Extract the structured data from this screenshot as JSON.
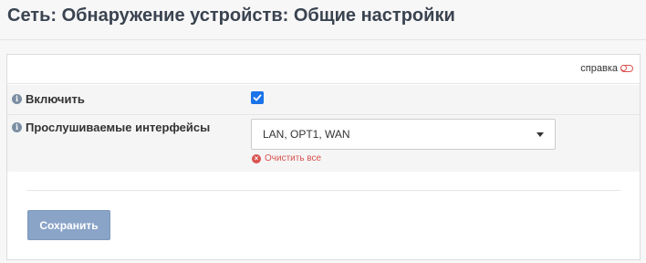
{
  "page": {
    "title": "Сеть: Обнаружение устройств: Общие настройки"
  },
  "help": {
    "label": "справка",
    "icon": "toggle-icon",
    "accent_color": "#d9534f"
  },
  "form": {
    "enable": {
      "label": "Включить",
      "checked": true,
      "icon": "info-icon"
    },
    "interfaces": {
      "label": "Прослушиваемые интерфейсы",
      "icon": "info-icon",
      "selected_value": "LAN, OPT1, WAN",
      "clear_all_label": "Очистить все",
      "clear_icon": "times-circle-icon"
    }
  },
  "footer": {
    "save_label": "Сохранить",
    "save_color": "#8aa4c8"
  }
}
